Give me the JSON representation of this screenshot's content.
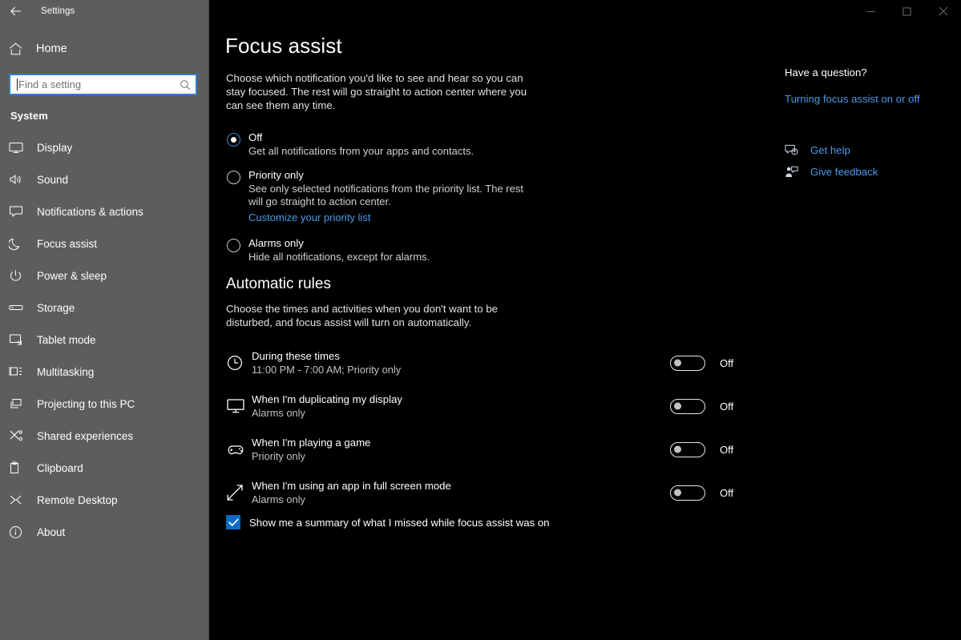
{
  "window": {
    "app_title": "Settings",
    "back_icon": "back-arrow-icon",
    "controls": {
      "minimize_label": "Minimize",
      "maximize_label": "Maximize",
      "close_label": "Close"
    }
  },
  "sidebar": {
    "home": {
      "label": "Home",
      "icon": "home-icon"
    },
    "search": {
      "value": "",
      "placeholder": "Find a setting",
      "icon": "search-icon"
    },
    "section_label": "System",
    "items": [
      {
        "label": "Display",
        "icon": "monitor-icon"
      },
      {
        "label": "Sound",
        "icon": "speaker-icon"
      },
      {
        "label": "Notifications & actions",
        "icon": "chat-bubble-icon"
      },
      {
        "label": "Focus assist",
        "icon": "moon-icon"
      },
      {
        "label": "Power & sleep",
        "icon": "power-icon"
      },
      {
        "label": "Storage",
        "icon": "drive-icon"
      },
      {
        "label": "Tablet mode",
        "icon": "tablet-icon"
      },
      {
        "label": "Multitasking",
        "icon": "multitasking-icon"
      },
      {
        "label": "Projecting to this PC",
        "icon": "projecting-icon"
      },
      {
        "label": "Shared experiences",
        "icon": "share-icon"
      },
      {
        "label": "Clipboard",
        "icon": "clipboard-icon"
      },
      {
        "label": "Remote Desktop",
        "icon": "remote-desktop-icon"
      },
      {
        "label": "About",
        "icon": "info-icon"
      }
    ]
  },
  "main": {
    "title": "Focus assist",
    "description": "Choose which notification you'd like to see and hear so you can stay focused. The rest will go straight to action center where you can see them any time.",
    "radio_options": [
      {
        "label": "Off",
        "description": "Get all notifications from your apps and contacts.",
        "selected": true,
        "link": null
      },
      {
        "label": "Priority only",
        "description": "See only selected notifications from the priority list. The rest will go straight to action center.",
        "selected": false,
        "link": "Customize your priority list"
      },
      {
        "label": "Alarms only",
        "description": "Hide all notifications, except for alarms.",
        "selected": false,
        "link": null
      }
    ],
    "automatic_rules": {
      "title": "Automatic rules",
      "description": "Choose the times and activities when you don't want to be disturbed, and focus assist will turn on automatically.",
      "rules": [
        {
          "title": "During these times",
          "subtitle": "11:00 PM - 7:00 AM; Priority only",
          "icon": "clock-icon",
          "toggle_state": "Off",
          "toggle_on": false
        },
        {
          "title": "When I'm duplicating my display",
          "subtitle": "Alarms only",
          "icon": "monitor-icon",
          "toggle_state": "Off",
          "toggle_on": false
        },
        {
          "title": "When I'm playing a game",
          "subtitle": "Priority only",
          "icon": "gamepad-icon",
          "toggle_state": "Off",
          "toggle_on": false
        },
        {
          "title": "When I'm using an app in full screen mode",
          "subtitle": "Alarms only",
          "icon": "fullscreen-arrows-icon",
          "toggle_state": "Off",
          "toggle_on": false
        }
      ]
    },
    "summary_checkbox": {
      "label": "Show me a summary of what I missed while focus assist was on",
      "checked": true
    }
  },
  "rail": {
    "title": "Have a question?",
    "help_link": "Turning focus assist on or off",
    "actions": [
      {
        "label": "Get help",
        "icon": "question-bubble-icon"
      },
      {
        "label": "Give feedback",
        "icon": "feedback-person-icon"
      }
    ]
  },
  "colors": {
    "accent_blue": "#4c9ae8",
    "selection_blue": "#0a6cc4",
    "sidebar_gray": "#5d5d5d",
    "background": "#000000"
  }
}
